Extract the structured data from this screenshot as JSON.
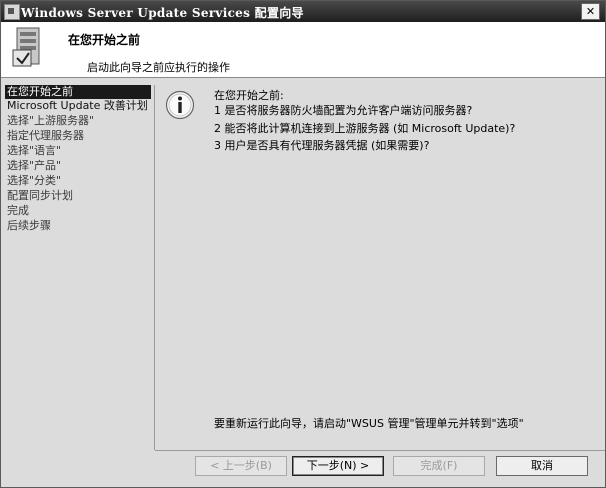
{
  "window": {
    "title": "Windows Server Update Services 配置向导",
    "close_glyph": "✕"
  },
  "header": {
    "title": "在您开始之前",
    "subtitle": "启动此向导之前应执行的操作",
    "icon": "wizard-server-icon"
  },
  "sidebar": {
    "items": [
      {
        "label": "在您开始之前",
        "active": true
      },
      {
        "label": "Microsoft Update 改善计划",
        "active": false
      },
      {
        "label": "选择\"上游服务器\"",
        "active": false
      },
      {
        "label": "指定代理服务器",
        "active": false
      },
      {
        "label": "选择\"语言\"",
        "active": false
      },
      {
        "label": "选择\"产品\"",
        "active": false
      },
      {
        "label": "选择\"分类\"",
        "active": false
      },
      {
        "label": "配置同步计划",
        "active": false
      },
      {
        "label": "完成",
        "active": false
      },
      {
        "label": "后续步骤",
        "active": false
      }
    ]
  },
  "content": {
    "info_icon": "info-icon",
    "intro": "在您开始之前:",
    "requirements": [
      "1   是否将服务器防火墙配置为允许客户端访问服务器?",
      "2   能否将此计算机连接到上游服务器 (如 Microsoft Update)?",
      "3   用户是否具有代理服务器凭据 (如果需要)?"
    ],
    "rerun_note": "要重新运行此向导，请启动\"WSUS 管理\"管理单元并转到\"选项\""
  },
  "buttons": {
    "back": "< 上一步(B)",
    "next": "下一步(N) >",
    "finish": "完成(F)",
    "cancel": "取消"
  }
}
